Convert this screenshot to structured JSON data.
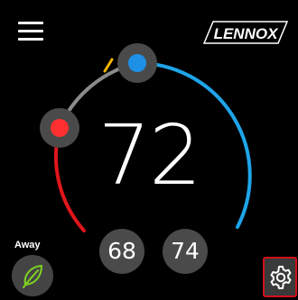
{
  "brand": {
    "name": "LENNOX",
    "logo_icon": "lennox-logo"
  },
  "menu": {
    "icon": "hamburger-menu-icon"
  },
  "thermostat": {
    "current_temperature": "72",
    "heat_setpoint": "68",
    "cool_setpoint": "74",
    "colors": {
      "heat": "#e0161c",
      "cool": "#1ea5ea",
      "marker": "#f0b400",
      "arc_neutral": "#8a8a8a"
    }
  },
  "away": {
    "label": "Away",
    "icon": "leaf-icon",
    "color": "#7ed321"
  },
  "settings": {
    "icon": "gear-icon",
    "highlight_color": "#d0101a"
  }
}
